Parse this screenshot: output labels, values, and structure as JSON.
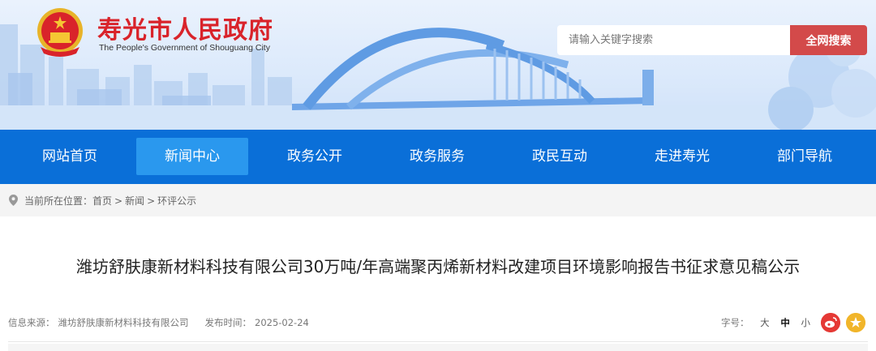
{
  "header": {
    "site_title": "寿光市人民政府",
    "site_subtitle": "The People's Government of Shouguang City",
    "search_placeholder": "请输入关键字搜索",
    "search_button": "全网搜索"
  },
  "nav": {
    "items": [
      {
        "label": "网站首页"
      },
      {
        "label": "新闻中心",
        "active": true
      },
      {
        "label": "政务公开"
      },
      {
        "label": "政务服务"
      },
      {
        "label": "政民互动"
      },
      {
        "label": "走进寿光"
      },
      {
        "label": "部门导航"
      }
    ]
  },
  "breadcrumb": {
    "prefix": "当前所在位置：",
    "items": [
      "首页",
      "新闻",
      "环评公示"
    ],
    "separator": ">"
  },
  "article": {
    "title": "潍坊舒肤康新材料科技有限公司30万吨/年高端聚丙烯新材料改建项目环境影响报告书征求意见稿公示",
    "source_label": "信息来源：",
    "source": "潍坊舒肤康新材料科技有限公司",
    "date_label": "发布时间：",
    "date": "2025-02-24",
    "font_size_label": "字号：",
    "font_sizes": [
      "大",
      "中",
      "小"
    ]
  },
  "colors": {
    "brand_red": "#d9232a",
    "nav_blue": "#0a6fd8",
    "nav_active": "#2a98ee",
    "search_button": "#d34a4a"
  },
  "icons": [
    "national-emblem-icon",
    "location-pin-icon",
    "weibo-icon",
    "wechat-icon"
  ]
}
